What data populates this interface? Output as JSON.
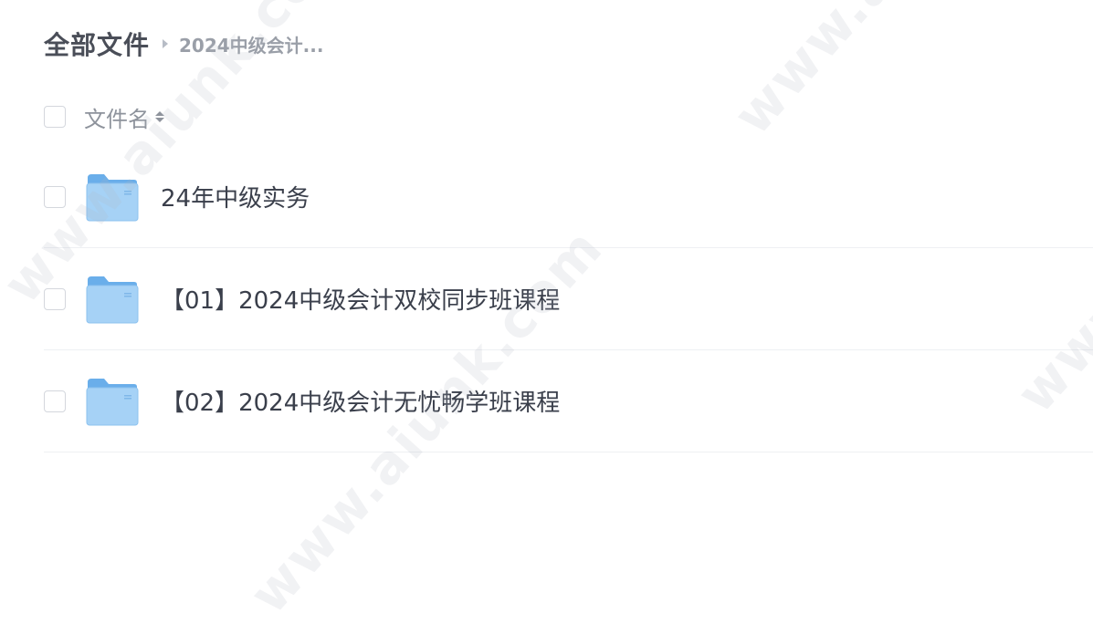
{
  "breadcrumb": {
    "root": "全部文件",
    "current": "2024中级会计..."
  },
  "header": {
    "name_label": "文件名"
  },
  "files": [
    {
      "name": "24年中级实务"
    },
    {
      "name": "【01】2024中级会计双校同步班课程"
    },
    {
      "name": "【02】2024中级会计无忧畅学班课程"
    }
  ],
  "watermark": {
    "text_1": "www.aiunk.com",
    "text_2": "www.aiunk.com",
    "text_3": "www.aiunk.com",
    "text_4": "www.aiunk.com"
  },
  "colors": {
    "folder_top": "#7ab8f0",
    "folder_body": "#9fd0f7",
    "divider": "#eef0f3"
  },
  "icons": {
    "breadcrumb_separator": "caret-right-icon",
    "sort": "sort-icon",
    "folder": "folder-icon"
  }
}
